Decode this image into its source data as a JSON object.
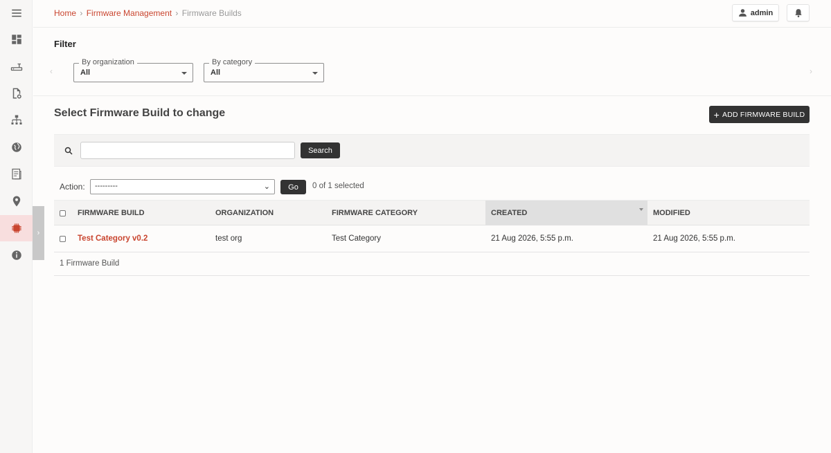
{
  "breadcrumb": {
    "home": "Home",
    "section": "Firmware Management",
    "current": "Firmware Builds",
    "separator": "›"
  },
  "topbar": {
    "user_label": "admin"
  },
  "sidebar": {
    "items": [
      {
        "icon": "menu-icon"
      },
      {
        "icon": "dashboard-icon"
      },
      {
        "icon": "router-device-icon"
      },
      {
        "icon": "file-settings-icon"
      },
      {
        "icon": "network-topology-icon"
      },
      {
        "icon": "globe-icon"
      },
      {
        "icon": "document-icon"
      },
      {
        "icon": "location-pin-icon"
      },
      {
        "icon": "chip-icon",
        "active": true
      },
      {
        "icon": "info-icon"
      }
    ],
    "toggle_glyph": "›"
  },
  "filter": {
    "title": "Filter",
    "prev_arrow": "‹",
    "next_arrow": "›",
    "by_organization": {
      "legend": "By organization",
      "value": "All"
    },
    "by_category": {
      "legend": "By category",
      "value": "All"
    }
  },
  "content": {
    "title": "Select Firmware Build to change",
    "add_button": "ADD FIRMWARE BUILD",
    "add_button_glyph": "+"
  },
  "search": {
    "value": "",
    "button": "Search"
  },
  "actions": {
    "label": "Action:",
    "selected_value": "---------",
    "go_button": "Go",
    "selected_count": "0 of 1 selected"
  },
  "table": {
    "columns": [
      "FIRMWARE BUILD",
      "ORGANIZATION",
      "FIRMWARE CATEGORY",
      "CREATED",
      "MODIFIED"
    ],
    "rows": [
      {
        "build": "Test Category v0.2",
        "organization": "test org",
        "category": "Test Category",
        "created": "21 Aug 2026, 5:55 p.m.",
        "modified": "21 Aug 2026, 5:55 p.m."
      }
    ],
    "footer": "1 Firmware Build"
  },
  "colors": {
    "accent": "#c9452f",
    "dark_button": "#333333",
    "active_sidebar": "#f8dede"
  }
}
